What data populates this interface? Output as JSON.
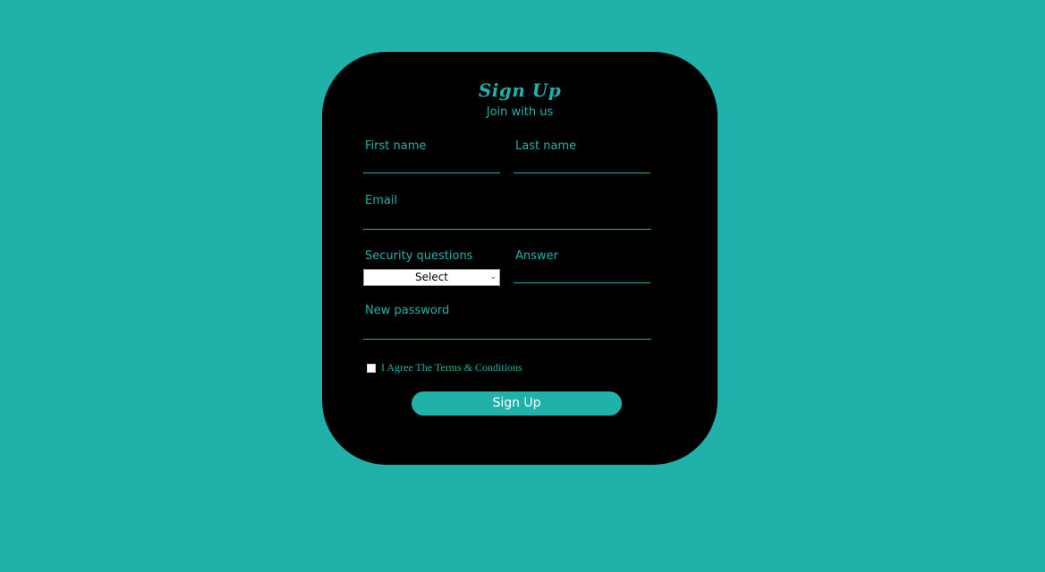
{
  "form": {
    "title": "Sign Up",
    "subtitle": "Join with us",
    "first_name_label": "First name",
    "last_name_label": "Last name",
    "email_label": "Email",
    "security_label": "Security questions",
    "security_selected": "Select",
    "answer_label": "Answer",
    "password_label": "New password",
    "terms_label": "I Agree The Terms & Conditions",
    "submit_label": "Sign Up"
  },
  "colors": {
    "background": "#20b2aa",
    "card": "#000000",
    "accent": "#20b2aa"
  }
}
